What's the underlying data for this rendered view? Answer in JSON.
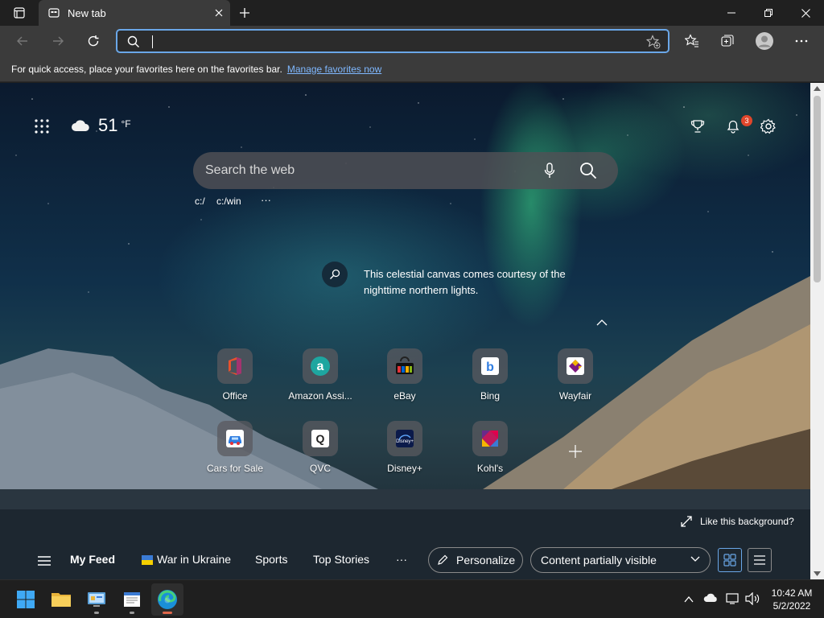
{
  "browser": {
    "tab_title": "New tab",
    "address_value": "",
    "favorites_bar": {
      "message": "For quick access, place your favorites here on the favorites bar.",
      "link": "Manage favorites now"
    }
  },
  "newtab": {
    "weather": {
      "temp": "51",
      "unit": "°F"
    },
    "notification_count": "3",
    "search_placeholder": "Search the web",
    "quick_links": [
      "c:/",
      "c:/win",
      "···"
    ],
    "caption": "This celestial canvas comes courtesy of the nighttime northern lights.",
    "tiles_row1": [
      "Office",
      "Amazon Assi...",
      "eBay",
      "Bing",
      "Wayfair"
    ],
    "tiles_row2": [
      "Cars for Sale",
      "QVC",
      "Disney+",
      "Kohl's"
    ],
    "like_background": "Like this background?",
    "feed": {
      "items": [
        "My Feed",
        "War in Ukraine",
        "Sports",
        "Top Stories"
      ],
      "more": "···",
      "personalize": "Personalize",
      "visibility": "Content partially visible"
    }
  },
  "taskbar": {
    "time": "10:42 AM",
    "date": "5/2/2022"
  },
  "colors": {
    "accent_focus": "#6aa7e8",
    "badge": "#e0462b",
    "link": "#7fb8ff"
  }
}
